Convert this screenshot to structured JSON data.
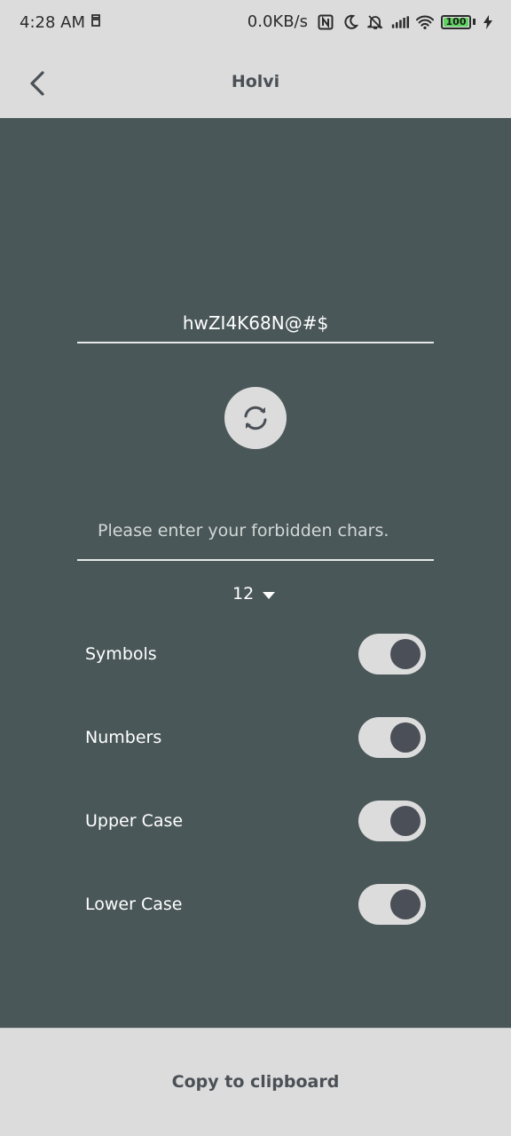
{
  "status_bar": {
    "time": "4:28 AM",
    "speed": "0.0KB/s",
    "battery": "100",
    "icons": [
      "nfc-icon",
      "moon-icon",
      "bell-off-icon",
      "signal-icon",
      "wifi-icon",
      "battery-icon",
      "charging-icon"
    ]
  },
  "app_bar": {
    "title": "Holvi",
    "back_icon": "chevron-left-icon"
  },
  "password": {
    "value": "hwZI4K68N@#$"
  },
  "refresh": {
    "icon": "refresh-icon"
  },
  "forbidden": {
    "placeholder": "Please enter your forbidden chars.",
    "value": ""
  },
  "length": {
    "value": "12"
  },
  "options": [
    {
      "label": "Symbols",
      "on": true
    },
    {
      "label": "Numbers",
      "on": true
    },
    {
      "label": "Upper Case",
      "on": true
    },
    {
      "label": "Lower Case",
      "on": true
    }
  ],
  "copy_button": {
    "label": "Copy to clipboard"
  },
  "colors": {
    "background": "#4a5758",
    "bar": "#dcdcdc",
    "knob": "#4b4f57",
    "text_dark": "#4a5056"
  }
}
